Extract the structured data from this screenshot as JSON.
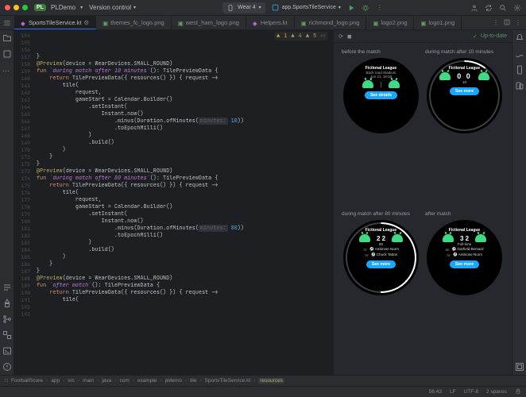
{
  "titlebar": {
    "project_badge": "PL",
    "project_name": "PLDemo",
    "vc_label": "Version control",
    "device_label": "Wear 4",
    "run_config": "app.SportsTileService"
  },
  "tabs": {
    "items": [
      {
        "label": "SportsTileService.kt",
        "type": "kt",
        "active": true
      },
      {
        "label": "themes_fc_logo.png",
        "type": "png",
        "active": false
      },
      {
        "label": "west_ham_logo.png",
        "type": "png",
        "active": false
      },
      {
        "label": "Helpers.kt",
        "type": "kt",
        "active": false
      },
      {
        "label": "richmond_logo.png",
        "type": "png",
        "active": false
      },
      {
        "label": "logo2.png",
        "type": "png",
        "active": false
      },
      {
        "label": "logo1.png",
        "type": "png",
        "active": false
      }
    ]
  },
  "inspection": {
    "warn_yellow": "1",
    "warn_weak": "4",
    "warn_tri": "5"
  },
  "code_lines": [
    {
      "n": 154,
      "raw": "}"
    },
    {
      "n": 155,
      "raw": ""
    },
    {
      "n": 156,
      "anno": "@Preview",
      "anno_arg": "(device = WearDevices.SMALL_ROUND)"
    },
    {
      "n": 157,
      "kw": "fun",
      "fnq": "`during match after 10 minutes`",
      "rest": "(): TilePreviewData {"
    },
    {
      "n": 158,
      "ret": "    return TilePreviewData({ resources() }) { request ->"
    },
    {
      "n": 159,
      "raw": "        tile("
    },
    {
      "n": 160,
      "raw": "            request,"
    },
    {
      "n": 161,
      "raw": "            gameStart = Calendar.Builder()"
    },
    {
      "n": 162,
      "raw": "                .setInstant("
    },
    {
      "n": 163,
      "raw": "                    Instant.now()"
    },
    {
      "n": 164,
      "minus": "                        .minus(Duration.ofMinutes(",
      "hint": "minutes:",
      "lit": " 10",
      "tail": "))"
    },
    {
      "n": 165,
      "raw": "                        .toEpochMilli()"
    },
    {
      "n": 166,
      "raw": "                )"
    },
    {
      "n": 167,
      "raw": "                .build()"
    },
    {
      "n": 168,
      "raw": "        )"
    },
    {
      "n": 169,
      "raw": "    }"
    },
    {
      "n": 170,
      "raw": "}"
    },
    {
      "n": 171,
      "raw": ""
    },
    {
      "n": 172,
      "anno": "@Preview",
      "anno_arg": "(device = WearDevices.SMALL_ROUND)"
    },
    {
      "n": 173,
      "kw": "fun",
      "fnq": "`during match after 80 minutes`",
      "rest": "(): TilePreviewData {"
    },
    {
      "n": 174,
      "ret": "    return TilePreviewData({ resources() }) { request ->"
    },
    {
      "n": 175,
      "raw": "        tile("
    },
    {
      "n": 176,
      "raw": "            request,"
    },
    {
      "n": 177,
      "raw": "            gameStart = Calendar.Builder()"
    },
    {
      "n": 178,
      "raw": "                .setInstant("
    },
    {
      "n": 179,
      "raw": "                    Instant.now()"
    },
    {
      "n": 180,
      "minus": "                        .minus(Duration.ofMinutes(",
      "hint": "minutes:",
      "lit": " 80",
      "tail": "))"
    },
    {
      "n": 181,
      "raw": "                        .toEpochMilli()"
    },
    {
      "n": 182,
      "raw": "                )"
    },
    {
      "n": 183,
      "raw": "                .build()"
    },
    {
      "n": 184,
      "raw": "        )"
    },
    {
      "n": 185,
      "raw": "    }"
    },
    {
      "n": 186,
      "raw": "}"
    },
    {
      "n": 187,
      "raw": ""
    },
    {
      "n": 188,
      "raw": ""
    },
    {
      "n": 189,
      "raw": ""
    },
    {
      "n": 190,
      "anno": "@Preview",
      "anno_arg": "(device = WearDevices.SMALL_ROUND)"
    },
    {
      "n": 191,
      "kw": "fun",
      "fnq": "`after match`",
      "rest": "(): TilePreviewData {"
    },
    {
      "n": 192,
      "ret": "    return TilePreviewData({ resources() }) { request ->"
    },
    {
      "n": 193,
      "raw": "        tile("
    }
  ],
  "preview": {
    "status": "Up-to-date",
    "cells": [
      {
        "label": "before the match",
        "league": "Fictional League",
        "stadium": "Back road Stadium",
        "date": "Jun 21, 19:00",
        "sep": "|",
        "button": "See details"
      },
      {
        "label": "during match after 10 minutes",
        "league": "Fictional League",
        "score": "0   0",
        "minute": "10",
        "button": "See more"
      },
      {
        "label": "during match after 80 minutes",
        "league": "Fictional League",
        "score": "2   2",
        "minute": "80",
        "player1": {
          "m": "70'",
          "name": "Ambrose Norm"
        },
        "player2": {
          "m": "70'",
          "name": "Chuck Tatton"
        },
        "button": "See more"
      },
      {
        "label": "after match",
        "league": "Fictional League",
        "score": "3   2",
        "fulltime": "Full-time",
        "player1": {
          "m": "85'",
          "name": "Garfield Bernard"
        },
        "player2": {
          "m": "70'",
          "name": "Ambrose Norm"
        },
        "button": "See more"
      }
    ]
  },
  "breadcrumbs": [
    "FootballScore",
    "app",
    "src",
    "main",
    "java",
    "com",
    "example",
    "pldemo",
    "tile",
    "SportsTileService.kt",
    "resources"
  ],
  "status": {
    "caret": "56:43",
    "line_sep": "LF",
    "encoding": "UTF-8",
    "indent": "2 spaces"
  }
}
